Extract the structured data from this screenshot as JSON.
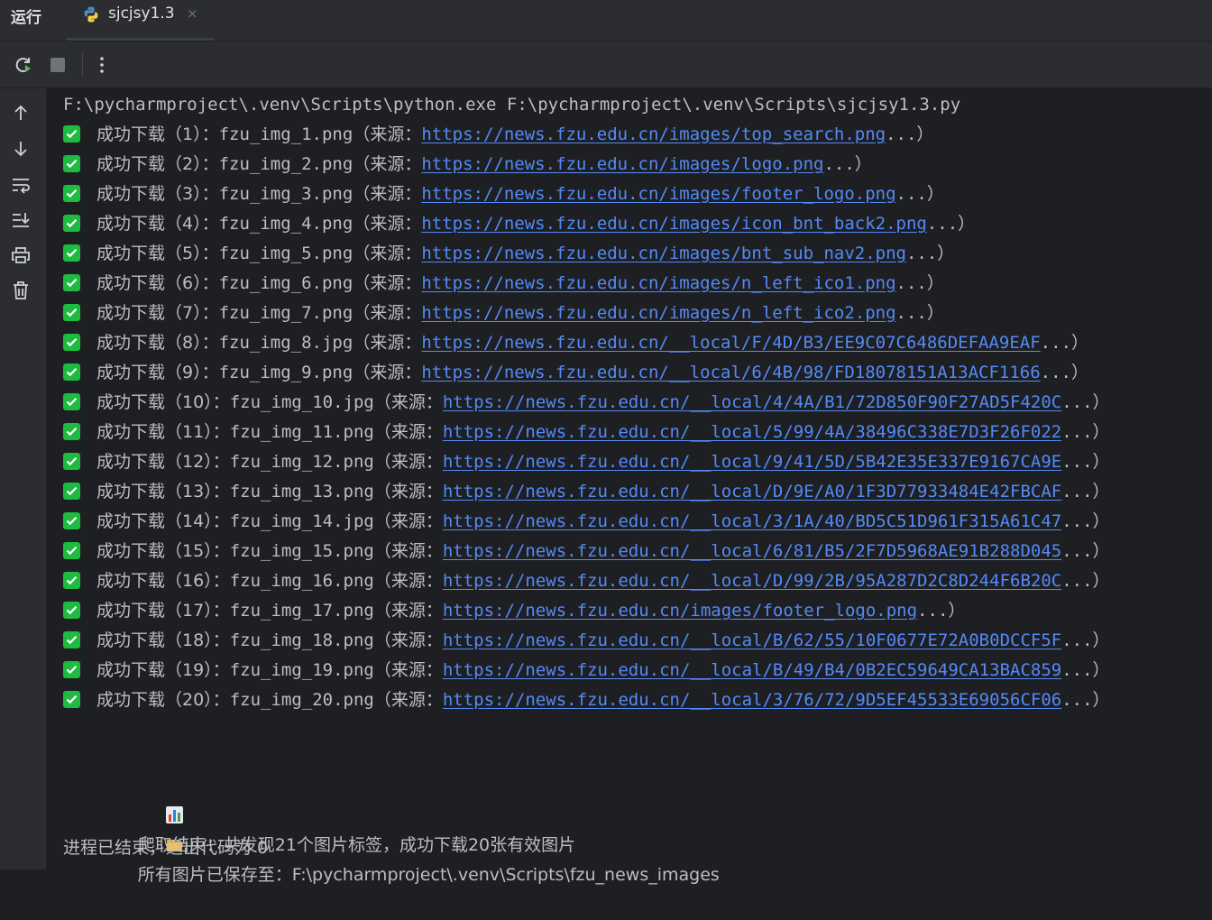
{
  "tool_window": {
    "title": "运行"
  },
  "tab": {
    "label": "sjcjsy1.3",
    "close": "×"
  },
  "colors": {
    "success_check": "#1dbb40",
    "link": "#548af7",
    "text": "#bcbec4",
    "background": "#1e1f22",
    "panel": "#2b2d30"
  },
  "toolbar": {
    "buttons": [
      "rerun-icon",
      "stop-icon",
      "more-options-icon"
    ]
  },
  "sidebar": {
    "buttons": [
      "up-arrow-icon",
      "down-arrow-icon",
      "soft-wrap-icon",
      "scroll-to-end-icon",
      "print-icon",
      "trash-icon"
    ]
  },
  "console": {
    "command": "F:\\pycharmproject\\.venv\\Scripts\\python.exe F:\\pycharmproject\\.venv\\Scripts\\sjcjsy1.3.py",
    "downloads": [
      {
        "prefix": "成功下载（1）：",
        "file": "fzu_img_1.png",
        "src_label": "（来源：",
        "url": "https://news.fzu.edu.cn/images/top_search.png",
        "suffix": "...）"
      },
      {
        "prefix": "成功下载（2）：",
        "file": "fzu_img_2.png",
        "src_label": "（来源：",
        "url": "https://news.fzu.edu.cn/images/logo.png",
        "suffix": "...）"
      },
      {
        "prefix": "成功下载（3）：",
        "file": "fzu_img_3.png",
        "src_label": "（来源：",
        "url": "https://news.fzu.edu.cn/images/footer_logo.png",
        "suffix": "...）"
      },
      {
        "prefix": "成功下载（4）：",
        "file": "fzu_img_4.png",
        "src_label": "（来源：",
        "url": "https://news.fzu.edu.cn/images/icon_bnt_back2.png",
        "suffix": "...）"
      },
      {
        "prefix": "成功下载（5）：",
        "file": "fzu_img_5.png",
        "src_label": "（来源：",
        "url": "https://news.fzu.edu.cn/images/bnt_sub_nav2.png",
        "suffix": "...）"
      },
      {
        "prefix": "成功下载（6）：",
        "file": "fzu_img_6.png",
        "src_label": "（来源：",
        "url": "https://news.fzu.edu.cn/images/n_left_ico1.png",
        "suffix": "...）"
      },
      {
        "prefix": "成功下载（7）：",
        "file": "fzu_img_7.png",
        "src_label": "（来源：",
        "url": "https://news.fzu.edu.cn/images/n_left_ico2.png",
        "suffix": "...）"
      },
      {
        "prefix": "成功下载（8）：",
        "file": "fzu_img_8.jpg",
        "src_label": "（来源：",
        "url": "https://news.fzu.edu.cn/__local/F/4D/B3/EE9C07C6486DEFAA9EAF",
        "suffix": "...）"
      },
      {
        "prefix": "成功下载（9）：",
        "file": "fzu_img_9.png",
        "src_label": "（来源：",
        "url": "https://news.fzu.edu.cn/__local/6/4B/98/FD18078151A13ACF1166",
        "suffix": "...）"
      },
      {
        "prefix": "成功下载（10）：",
        "file": "fzu_img_10.jpg",
        "src_label": "（来源：",
        "url": "https://news.fzu.edu.cn/__local/4/4A/B1/72D850F90F27AD5F420C",
        "suffix": "...）"
      },
      {
        "prefix": "成功下载（11）：",
        "file": "fzu_img_11.png",
        "src_label": "（来源：",
        "url": "https://news.fzu.edu.cn/__local/5/99/4A/38496C338E7D3F26F022",
        "suffix": "...）"
      },
      {
        "prefix": "成功下载（12）：",
        "file": "fzu_img_12.png",
        "src_label": "（来源：",
        "url": "https://news.fzu.edu.cn/__local/9/41/5D/5B42E35E337E9167CA9E",
        "suffix": "...）"
      },
      {
        "prefix": "成功下载（13）：",
        "file": "fzu_img_13.png",
        "src_label": "（来源：",
        "url": "https://news.fzu.edu.cn/__local/D/9E/A0/1F3D77933484E42FBCAF",
        "suffix": "...）"
      },
      {
        "prefix": "成功下载（14）：",
        "file": "fzu_img_14.jpg",
        "src_label": "（来源：",
        "url": "https://news.fzu.edu.cn/__local/3/1A/40/BD5C51D961F315A61C47",
        "suffix": "...）"
      },
      {
        "prefix": "成功下载（15）：",
        "file": "fzu_img_15.png",
        "src_label": "（来源：",
        "url": "https://news.fzu.edu.cn/__local/6/81/B5/2F7D5968AE91B288D045",
        "suffix": "...）"
      },
      {
        "prefix": "成功下载（16）：",
        "file": "fzu_img_16.png",
        "src_label": "（来源：",
        "url": "https://news.fzu.edu.cn/__local/D/99/2B/95A287D2C8D244F6B20C",
        "suffix": "...）"
      },
      {
        "prefix": "成功下载（17）：",
        "file": "fzu_img_17.png",
        "src_label": "（来源：",
        "url": "https://news.fzu.edu.cn/images/footer_logo.png",
        "suffix": "...）"
      },
      {
        "prefix": "成功下载（18）：",
        "file": "fzu_img_18.png",
        "src_label": "（来源：",
        "url": "https://news.fzu.edu.cn/__local/B/62/55/10F0677E72A0B0DCCF5F",
        "suffix": "...）"
      },
      {
        "prefix": "成功下载（19）：",
        "file": "fzu_img_19.png",
        "src_label": "（来源：",
        "url": "https://news.fzu.edu.cn/__local/B/49/B4/0B2EC59649CA13BAC859",
        "suffix": "...）"
      },
      {
        "prefix": "成功下载（20）：",
        "file": "fzu_img_20.png",
        "src_label": "（来源：",
        "url": "https://news.fzu.edu.cn/__local/3/76/72/9D5EF45533E69056CF06",
        "suffix": "...）"
      }
    ],
    "summary": {
      "icon": "bar-chart-icon",
      "text": "爬取结束：共发现21个图片标签，成功下载20张有效图片"
    },
    "saved": {
      "icon": "folder-icon",
      "text": "所有图片已保存至：F:\\pycharmproject\\.venv\\Scripts\\fzu_news_images"
    },
    "exit": "进程已结束，退出代码为 0"
  }
}
